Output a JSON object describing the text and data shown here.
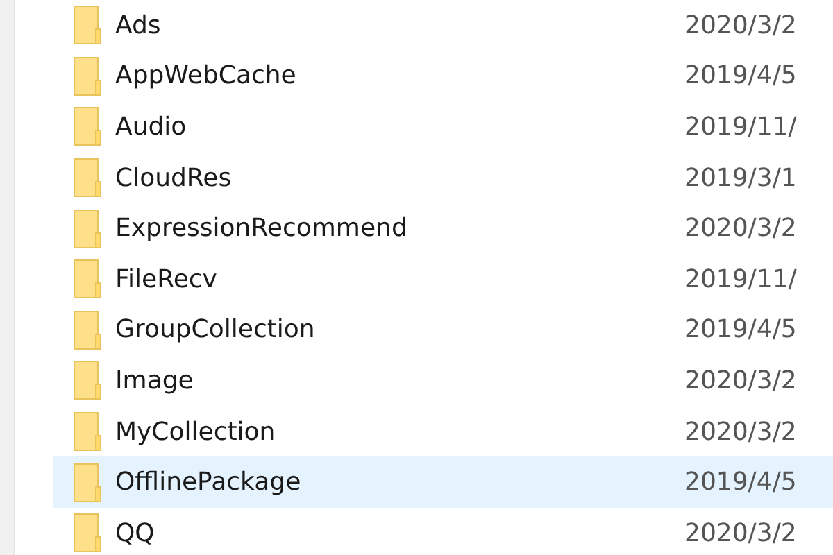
{
  "files": [
    {
      "name": "Ads",
      "date": "2020/3/2",
      "selected": false
    },
    {
      "name": "AppWebCache",
      "date": "2019/4/5",
      "selected": false
    },
    {
      "name": "Audio",
      "date": "2019/11/",
      "selected": false
    },
    {
      "name": "CloudRes",
      "date": "2019/3/1",
      "selected": false
    },
    {
      "name": "ExpressionRecommend",
      "date": "2020/3/2",
      "selected": false
    },
    {
      "name": "FileRecv",
      "date": "2019/11/",
      "selected": false
    },
    {
      "name": "GroupCollection",
      "date": "2019/4/5",
      "selected": false
    },
    {
      "name": "Image",
      "date": "2020/3/2",
      "selected": false
    },
    {
      "name": "MyCollection",
      "date": "2020/3/2",
      "selected": false
    },
    {
      "name": "OfflinePackage",
      "date": "2019/4/5",
      "selected": true
    },
    {
      "name": "QQ",
      "date": "2020/3/2",
      "selected": false
    }
  ]
}
